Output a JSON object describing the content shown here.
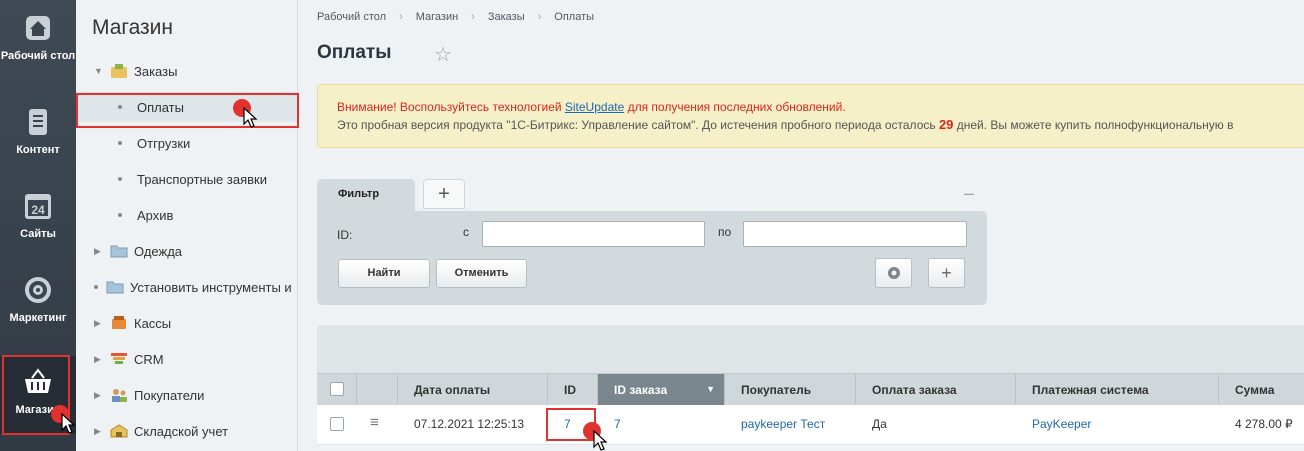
{
  "leftbar": [
    {
      "label": "Рабочий стол",
      "icon": "home-icon"
    },
    {
      "label": "Контент",
      "icon": "document-icon"
    },
    {
      "label": "Сайты",
      "icon": "calendar-icon"
    },
    {
      "label": "Маркетинг",
      "icon": "target-icon"
    },
    {
      "label": "Магазин",
      "icon": "basket-icon"
    }
  ],
  "menu": {
    "title": "Магазин",
    "items": [
      {
        "label": "Заказы",
        "icon": "orders-icon"
      },
      {
        "label": "Оплаты"
      },
      {
        "label": "Отгрузки"
      },
      {
        "label": "Транспортные заявки"
      },
      {
        "label": "Архив"
      },
      {
        "label": "Одежда",
        "icon": "folder-icon"
      },
      {
        "label": "Установить инструменты и",
        "icon": "folder-icon"
      },
      {
        "label": "Кассы",
        "icon": "cashbox-icon"
      },
      {
        "label": "CRM",
        "icon": "crm-icon"
      },
      {
        "label": "Покупатели",
        "icon": "users-icon"
      },
      {
        "label": "Складской учет",
        "icon": "warehouse-icon"
      }
    ]
  },
  "breadcrumb": [
    "Рабочий стол",
    "Магазин",
    "Заказы",
    "Оплаты"
  ],
  "page_title": "Оплаты",
  "alert": {
    "prefix": "Внимание! Воспользуйтесь технологией ",
    "link": "SiteUpdate",
    "suffix": " для получения последних обновлений.",
    "line2_start": "Это пробная версия продукта \"1С-Битрикс: Управление сайтом\". До истечения пробного периода осталось ",
    "days": "29",
    "line2_end": " дней. Вы можете купить полнофункциональную в"
  },
  "filter": {
    "tab_label": "Фильтр",
    "add_tab": "+",
    "collapse": "–",
    "id_label": "ID:",
    "from_label": "с",
    "to_label": "по",
    "from_value": "",
    "to_value": "",
    "find_button": "Найти",
    "cancel_button": "Отменить",
    "plus": "+"
  },
  "grid": {
    "columns": [
      "Дата оплаты",
      "ID",
      "ID заказа",
      "Покупатель",
      "Оплата заказа",
      "Платежная система",
      "Сумма"
    ],
    "rows": [
      {
        "date": "07.12.2021 12:25:13",
        "id": "7",
        "order_id": "7",
        "buyer_login": "paykeeper",
        "buyer_name": " Тест",
        "paid": "Да",
        "pay_system": "PayKeeper",
        "sum": "4 278.00 ₽"
      }
    ]
  },
  "colors": {
    "accent": "#e2322f",
    "link": "#2067b0",
    "sidebar": "#3a444e"
  }
}
